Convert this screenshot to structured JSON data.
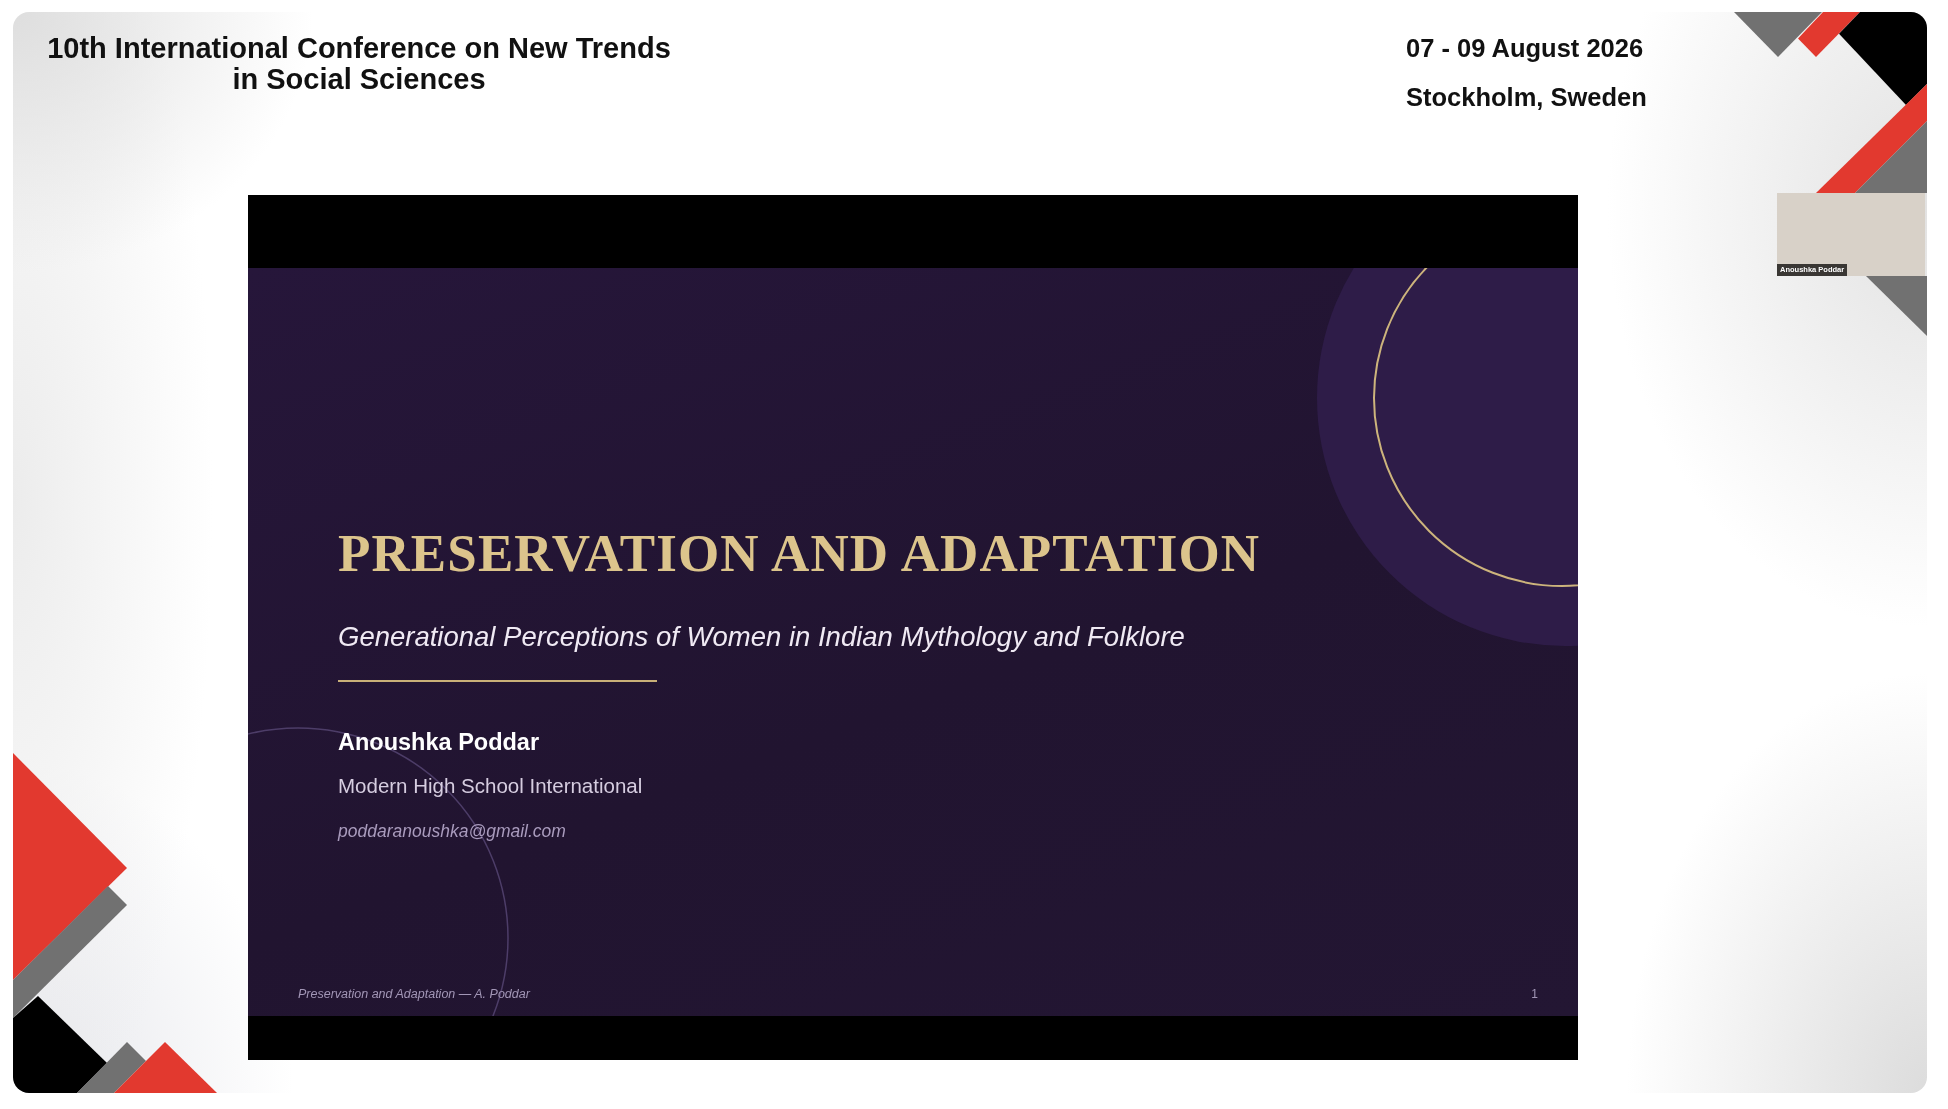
{
  "header": {
    "title": "10th International Conference on New Trends in Social Sciences",
    "dates": "07 - 09 August 2026",
    "location": "Stockholm, Sweden"
  },
  "shared_slide": {
    "title": "PRESERVATION AND ADAPTATION",
    "subtitle": "Generational Perceptions of Women in Indian Mythology and Folklore",
    "author": "Anoushka Poddar",
    "affiliation": "Modern High School International",
    "email": "poddaranoushka@gmail.com",
    "footer": "Preservation and Adaptation — A. Poddar",
    "page_number": "1"
  },
  "video_tile": {
    "participant_name": "Anoushka Poddar"
  }
}
